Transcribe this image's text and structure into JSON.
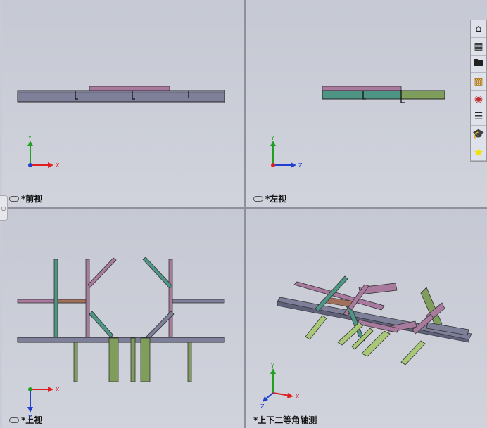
{
  "toolbar": {
    "icons": [
      "zoom-fit-icon",
      "zoom-area-icon",
      "previous-view-icon",
      "section-view-icon",
      "view-orientation-icon",
      "display-style-icon",
      "hide-show-icon",
      "edit-appearance-icon",
      "apply-scene-icon",
      "view-settings-icon"
    ]
  },
  "viewports": {
    "front": {
      "label": "*前视",
      "axis_x": "X",
      "axis_y": "Y"
    },
    "left": {
      "label": "*左视",
      "axis_z": "Z",
      "axis_y": "Y"
    },
    "top": {
      "label": "*上视",
      "axis_x": "X",
      "axis_z": "Z"
    },
    "iso": {
      "label": "*上下二等角轴测",
      "axis_x": "X",
      "axis_y": "Y",
      "axis_z": "Z"
    }
  },
  "taskpane": {
    "icons": [
      "home-icon",
      "design-library-icon",
      "file-explorer-icon",
      "view-palette-icon",
      "appearances-icon",
      "custom-properties-icon",
      "tutorial-icon",
      "favorites-star-icon"
    ]
  },
  "colors": {
    "beam_gray": "#7e7f99",
    "beam_green": "#7f9e5c",
    "beam_pink": "#a87a9e",
    "beam_teal": "#4f9585",
    "axis_x": "#e02020",
    "axis_y": "#20a020",
    "axis_z": "#2040d0"
  }
}
